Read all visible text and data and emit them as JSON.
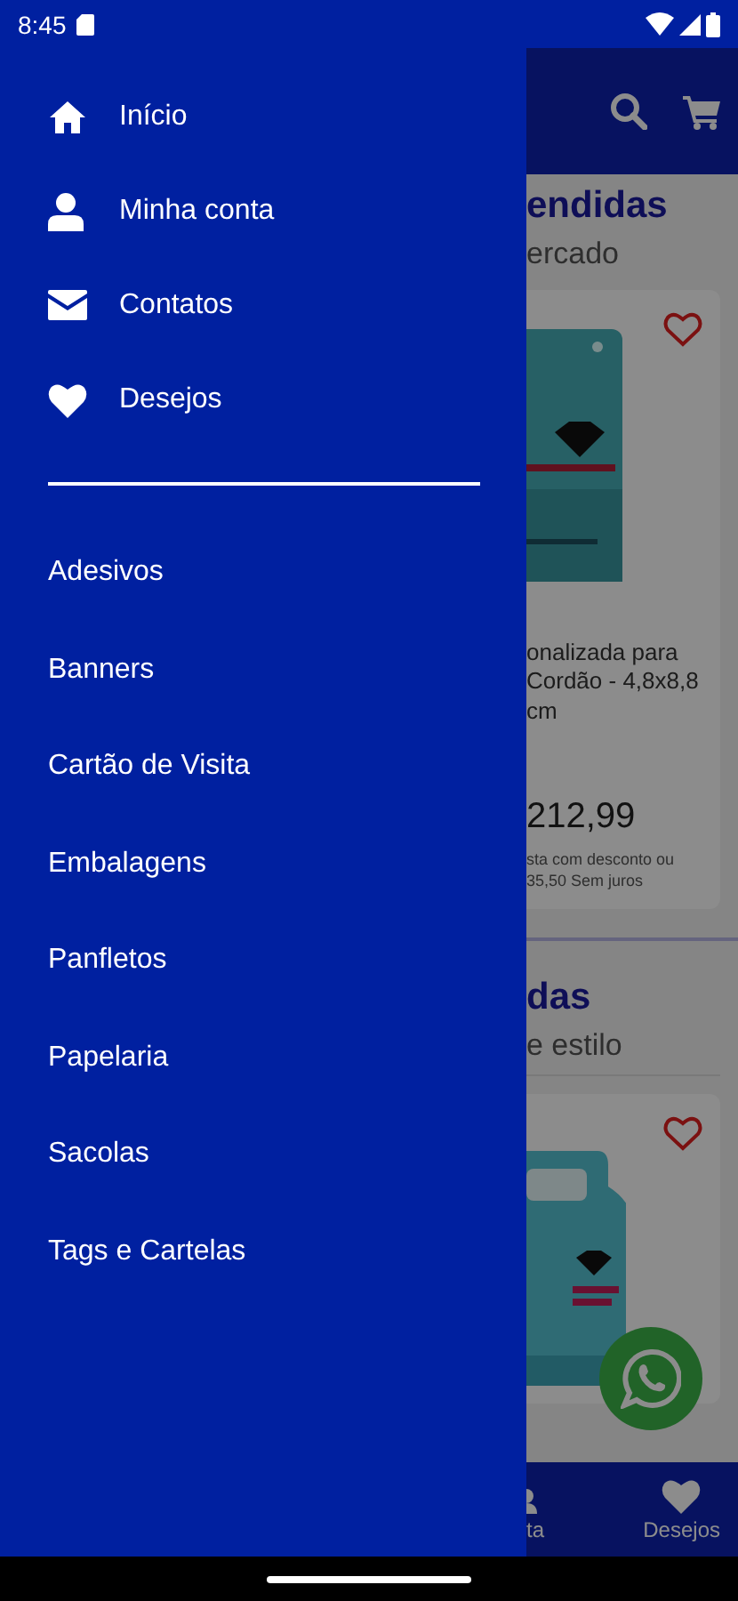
{
  "status_bar": {
    "time": "8:45"
  },
  "drawer": {
    "menu": [
      {
        "label": "Início"
      },
      {
        "label": "Minha conta"
      },
      {
        "label": "Contatos"
      },
      {
        "label": "Desejos"
      }
    ],
    "categories": [
      "Adesivos",
      "Banners",
      "Cartão de Visita",
      "Embalagens",
      "Panfletos",
      "Papelaria",
      "Sacolas",
      "Tags e Cartelas"
    ]
  },
  "background_screen": {
    "sections": [
      {
        "title": "endidas",
        "subtitle": "ercado",
        "product": {
          "favorite": false,
          "name": "onalizada para\nCordão - 4,8x8,8\ncm",
          "price": "212,99",
          "terms": "sta com desconto ou\n35,50 Sem juros"
        }
      },
      {
        "title": "das",
        "subtitle": "e estilo",
        "product": {
          "favorite": false
        }
      }
    ],
    "bottom_nav": [
      {
        "label": "ta"
      },
      {
        "label": "Desejos"
      }
    ]
  }
}
